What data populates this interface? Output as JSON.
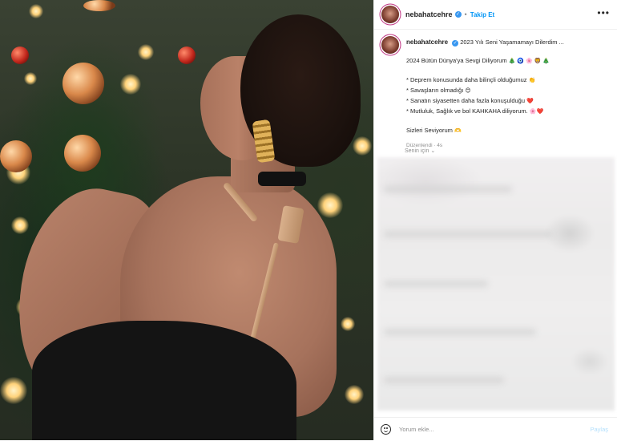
{
  "post": {
    "username": "nebahatcehre",
    "follow_label": "Takip Et",
    "separator": "•",
    "more_icon": "more-horizontal-icon"
  },
  "caption": {
    "username": "nebahatcehre",
    "first_line": "2023 Yılı Seni Yaşamamayı Dilerdim ...",
    "line2": "2024 Bütün Dünya'ya Sevgi Diliyorum",
    "line2_emojis": "🎄 🧿 🌸 🦁 🎄",
    "bullets": [
      {
        "text": "* Deprem konusunda daha bilinçli olduğumuz",
        "emoji": "👏"
      },
      {
        "text": "* Savaşların olmadığı",
        "emoji": "😊"
      },
      {
        "text": "* Sanatın siyasetten daha fazla konuşulduğu",
        "emoji": "❤️"
      },
      {
        "text": "* Mutluluk, Sağlık ve bol KAHKAHA diliyorum.",
        "emoji": "🌸❤️"
      }
    ],
    "closing": "Sizleri Seviyorum",
    "closing_emoji": "🫶",
    "meta": "Düzenlendi · 4s"
  },
  "for_you": "Senin için",
  "comment_box": {
    "placeholder": "Yorum ekle...",
    "post_label": "Paylaş"
  },
  "colors": {
    "link_blue": "#0095f6",
    "verified_blue": "#3897f0",
    "muted": "#8e8e8e"
  }
}
